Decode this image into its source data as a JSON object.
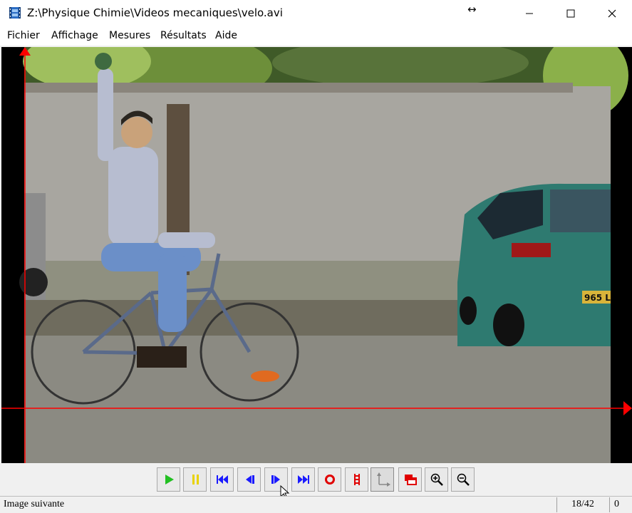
{
  "window": {
    "title": "Z:\\Physique Chimie\\Videos mecaniques\\velo.avi",
    "resize_glyph": "↔"
  },
  "menu": {
    "items": [
      "Fichier",
      "Affichage",
      "Mesures",
      "Résultats",
      "Aide"
    ]
  },
  "video": {
    "plate_text": "965 L"
  },
  "toolbar": {
    "buttons": [
      {
        "name": "play-button",
        "icon": "play-icon",
        "color": "#22c022"
      },
      {
        "name": "pause-button",
        "icon": "pause-icon",
        "color": "#e8d200"
      },
      {
        "name": "first-frame-button",
        "icon": "skip-first-icon",
        "color": "#1a1aff"
      },
      {
        "name": "previous-frame-button",
        "icon": "step-back-icon",
        "color": "#1a1aff"
      },
      {
        "name": "next-frame-button",
        "icon": "step-forward-icon",
        "color": "#1a1aff"
      },
      {
        "name": "last-frame-button",
        "icon": "skip-last-icon",
        "color": "#1a1aff"
      },
      {
        "name": "record-button",
        "icon": "record-icon",
        "color": "#e00000"
      },
      {
        "name": "scale-button",
        "icon": "ruler-icon",
        "color": "#e00000"
      },
      {
        "name": "axes-button",
        "icon": "axes-icon",
        "color": "#888888"
      },
      {
        "name": "window-button",
        "icon": "window-icon",
        "color": "#e00000"
      },
      {
        "name": "zoom-in-button",
        "icon": "zoom-in-icon",
        "color": "#000000"
      },
      {
        "name": "zoom-out-button",
        "icon": "zoom-out-icon",
        "color": "#000000"
      }
    ]
  },
  "status": {
    "message": "Image suivante",
    "frame": "18/42",
    "count": "0"
  },
  "colors": {
    "axis_red": "#ff0000"
  }
}
